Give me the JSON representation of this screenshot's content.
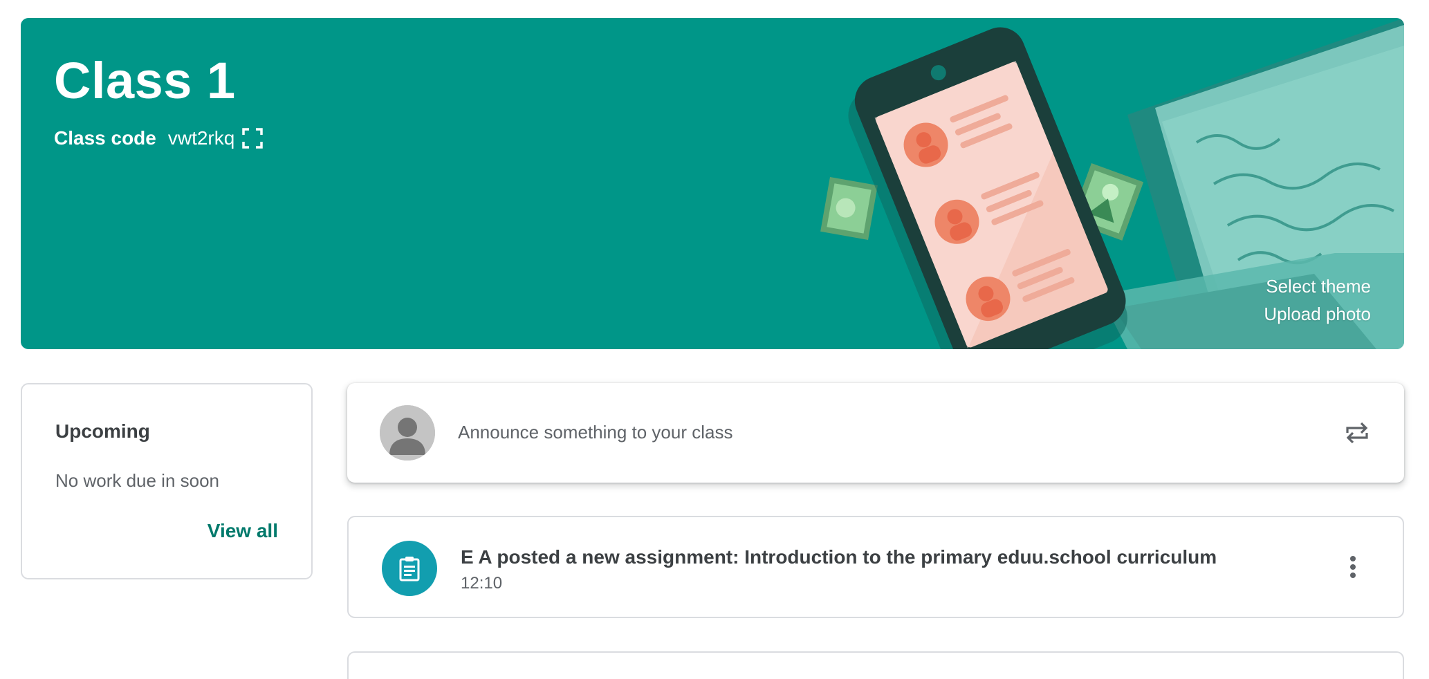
{
  "banner": {
    "class_name": "Class 1",
    "class_code_label": "Class code",
    "class_code": "vwt2rkq",
    "select_theme": "Select theme",
    "upload_photo": "Upload photo",
    "theme_color": "#009688",
    "expand_icon": "fullscreen-icon"
  },
  "upcoming": {
    "title": "Upcoming",
    "empty_text": "No work due in soon",
    "view_all": "View all",
    "link_color": "#00796b"
  },
  "announce": {
    "placeholder": "Announce something to your class",
    "avatar_icon": "person-icon",
    "action_icon": "repost-icon"
  },
  "stream": [
    {
      "title": "E A posted a new assignment: Introduction to the primary eduu.school curriculum",
      "time": "12:10",
      "icon": "assignment-icon",
      "icon_color": "#129eaf",
      "menu_icon": "more-vert-icon"
    }
  ]
}
